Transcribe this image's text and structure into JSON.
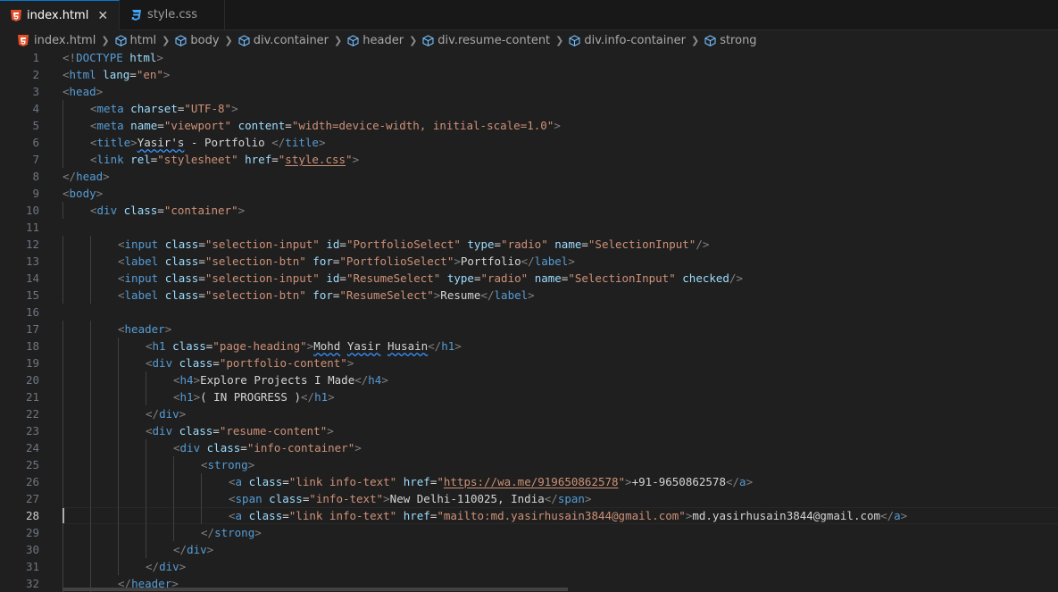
{
  "tabs": [
    {
      "label": "index.html",
      "active": true,
      "icon": "html5-icon"
    },
    {
      "label": "style.css",
      "active": false,
      "icon": "css3-icon"
    }
  ],
  "breadcrumb": [
    "index.html",
    "html",
    "body",
    "div.container",
    "header",
    "div.resume-content",
    "div.info-container",
    "strong"
  ],
  "colors": {
    "accent": "#0078d4",
    "tag": "#569cd6",
    "attribute": "#9cdcfe",
    "string": "#ce9178",
    "html_icon": "#e44d26",
    "css_icon": "#42a5f5"
  },
  "current_line": 28,
  "lines": [
    {
      "n": "1",
      "indent": 0,
      "tokens": [
        [
          "p",
          "<!"
        ],
        [
          "t",
          "DOCTYPE"
        ],
        [
          "tx",
          " "
        ],
        [
          "a",
          "html"
        ],
        [
          "p",
          ">"
        ]
      ]
    },
    {
      "n": "2",
      "indent": 0,
      "tokens": [
        [
          "p",
          "<"
        ],
        [
          "t",
          "html"
        ],
        [
          "tx",
          " "
        ],
        [
          "a",
          "lang"
        ],
        [
          "tx",
          "="
        ],
        [
          "s",
          "\"en\""
        ],
        [
          "p",
          ">"
        ]
      ]
    },
    {
      "n": "3",
      "indent": 0,
      "tokens": [
        [
          "p",
          "<"
        ],
        [
          "t",
          "head"
        ],
        [
          "p",
          ">"
        ]
      ]
    },
    {
      "n": "4",
      "indent": 1,
      "tokens": [
        [
          "p",
          "<"
        ],
        [
          "t",
          "meta"
        ],
        [
          "tx",
          " "
        ],
        [
          "a",
          "charset"
        ],
        [
          "tx",
          "="
        ],
        [
          "s",
          "\"UTF-8\""
        ],
        [
          "p",
          ">"
        ]
      ]
    },
    {
      "n": "5",
      "indent": 1,
      "tokens": [
        [
          "p",
          "<"
        ],
        [
          "t",
          "meta"
        ],
        [
          "tx",
          " "
        ],
        [
          "a",
          "name"
        ],
        [
          "tx",
          "="
        ],
        [
          "s",
          "\"viewport\""
        ],
        [
          "tx",
          " "
        ],
        [
          "a",
          "content"
        ],
        [
          "tx",
          "="
        ],
        [
          "s",
          "\"width=device-width, initial-scale=1.0\""
        ],
        [
          "p",
          ">"
        ]
      ]
    },
    {
      "n": "6",
      "indent": 1,
      "tokens": [
        [
          "p",
          "<"
        ],
        [
          "t",
          "title"
        ],
        [
          "p",
          ">"
        ],
        [
          "tx sq",
          "Yasir's"
        ],
        [
          "tx",
          " - Portfolio "
        ],
        [
          "p",
          "</"
        ],
        [
          "t",
          "title"
        ],
        [
          "p",
          ">"
        ]
      ]
    },
    {
      "n": "7",
      "indent": 1,
      "tokens": [
        [
          "p",
          "<"
        ],
        [
          "t",
          "link"
        ],
        [
          "tx",
          " "
        ],
        [
          "a",
          "rel"
        ],
        [
          "tx",
          "="
        ],
        [
          "s",
          "\"stylesheet\""
        ],
        [
          "tx",
          " "
        ],
        [
          "a",
          "href"
        ],
        [
          "tx",
          "="
        ],
        [
          "s",
          "\""
        ],
        [
          "s ul",
          "style.css"
        ],
        [
          "s",
          "\""
        ],
        [
          "p",
          ">"
        ]
      ]
    },
    {
      "n": "8",
      "indent": 0,
      "tokens": [
        [
          "p",
          "</"
        ],
        [
          "t",
          "head"
        ],
        [
          "p",
          ">"
        ]
      ]
    },
    {
      "n": "9",
      "indent": 0,
      "tokens": [
        [
          "p",
          "<"
        ],
        [
          "t",
          "body"
        ],
        [
          "p",
          ">"
        ]
      ]
    },
    {
      "n": "10",
      "indent": 1,
      "tokens": [
        [
          "p",
          "<"
        ],
        [
          "t",
          "div"
        ],
        [
          "tx",
          " "
        ],
        [
          "a",
          "class"
        ],
        [
          "tx",
          "="
        ],
        [
          "s",
          "\"container\""
        ],
        [
          "p",
          ">"
        ]
      ]
    },
    {
      "n": "11",
      "indent": 0,
      "tokens": []
    },
    {
      "n": "12",
      "indent": 2,
      "tokens": [
        [
          "p",
          "<"
        ],
        [
          "t",
          "input"
        ],
        [
          "tx",
          " "
        ],
        [
          "a",
          "class"
        ],
        [
          "tx",
          "="
        ],
        [
          "s",
          "\"selection-input\""
        ],
        [
          "tx",
          " "
        ],
        [
          "a",
          "id"
        ],
        [
          "tx",
          "="
        ],
        [
          "s",
          "\"PortfolioSelect\""
        ],
        [
          "tx",
          " "
        ],
        [
          "a",
          "type"
        ],
        [
          "tx",
          "="
        ],
        [
          "s",
          "\"radio\""
        ],
        [
          "tx",
          " "
        ],
        [
          "a",
          "name"
        ],
        [
          "tx",
          "="
        ],
        [
          "s",
          "\"SelectionInput\""
        ],
        [
          "p",
          "/>"
        ]
      ]
    },
    {
      "n": "13",
      "indent": 2,
      "tokens": [
        [
          "p",
          "<"
        ],
        [
          "t",
          "label"
        ],
        [
          "tx",
          " "
        ],
        [
          "a",
          "class"
        ],
        [
          "tx",
          "="
        ],
        [
          "s",
          "\"selection-btn\""
        ],
        [
          "tx",
          " "
        ],
        [
          "a",
          "for"
        ],
        [
          "tx",
          "="
        ],
        [
          "s",
          "\"PortfolioSelect\""
        ],
        [
          "p",
          ">"
        ],
        [
          "tx",
          "Portfolio"
        ],
        [
          "p",
          "</"
        ],
        [
          "t",
          "label"
        ],
        [
          "p",
          ">"
        ]
      ]
    },
    {
      "n": "14",
      "indent": 2,
      "tokens": [
        [
          "p",
          "<"
        ],
        [
          "t",
          "input"
        ],
        [
          "tx",
          " "
        ],
        [
          "a",
          "class"
        ],
        [
          "tx",
          "="
        ],
        [
          "s",
          "\"selection-input\""
        ],
        [
          "tx",
          " "
        ],
        [
          "a",
          "id"
        ],
        [
          "tx",
          "="
        ],
        [
          "s",
          "\"ResumeSelect\""
        ],
        [
          "tx",
          " "
        ],
        [
          "a",
          "type"
        ],
        [
          "tx",
          "="
        ],
        [
          "s",
          "\"radio\""
        ],
        [
          "tx",
          " "
        ],
        [
          "a",
          "name"
        ],
        [
          "tx",
          "="
        ],
        [
          "s",
          "\"SelectionInput\""
        ],
        [
          "tx",
          " "
        ],
        [
          "a",
          "checked"
        ],
        [
          "p",
          "/>"
        ]
      ]
    },
    {
      "n": "15",
      "indent": 2,
      "tokens": [
        [
          "p",
          "<"
        ],
        [
          "t",
          "label"
        ],
        [
          "tx",
          " "
        ],
        [
          "a",
          "class"
        ],
        [
          "tx",
          "="
        ],
        [
          "s",
          "\"selection-btn\""
        ],
        [
          "tx",
          " "
        ],
        [
          "a",
          "for"
        ],
        [
          "tx",
          "="
        ],
        [
          "s",
          "\"ResumeSelect\""
        ],
        [
          "p",
          ">"
        ],
        [
          "tx",
          "Resume"
        ],
        [
          "p",
          "</"
        ],
        [
          "t",
          "label"
        ],
        [
          "p",
          ">"
        ]
      ]
    },
    {
      "n": "16",
      "indent": 0,
      "tokens": []
    },
    {
      "n": "17",
      "indent": 2,
      "tokens": [
        [
          "p",
          "<"
        ],
        [
          "t",
          "header"
        ],
        [
          "p",
          ">"
        ]
      ]
    },
    {
      "n": "18",
      "indent": 3,
      "tokens": [
        [
          "p",
          "<"
        ],
        [
          "t",
          "h1"
        ],
        [
          "tx",
          " "
        ],
        [
          "a",
          "class"
        ],
        [
          "tx",
          "="
        ],
        [
          "s",
          "\"page-heading\""
        ],
        [
          "p",
          ">"
        ],
        [
          "tx sq",
          "Mohd"
        ],
        [
          "tx",
          " "
        ],
        [
          "tx sq",
          "Yasir"
        ],
        [
          "tx",
          " "
        ],
        [
          "tx sq",
          "Husain"
        ],
        [
          "p",
          "</"
        ],
        [
          "t",
          "h1"
        ],
        [
          "p",
          ">"
        ]
      ]
    },
    {
      "n": "19",
      "indent": 3,
      "tokens": [
        [
          "p",
          "<"
        ],
        [
          "t",
          "div"
        ],
        [
          "tx",
          " "
        ],
        [
          "a",
          "class"
        ],
        [
          "tx",
          "="
        ],
        [
          "s",
          "\"portfolio-content\""
        ],
        [
          "p",
          ">"
        ]
      ]
    },
    {
      "n": "20",
      "indent": 4,
      "tokens": [
        [
          "p",
          "<"
        ],
        [
          "t",
          "h4"
        ],
        [
          "p",
          ">"
        ],
        [
          "tx",
          "Explore Projects I Made"
        ],
        [
          "p",
          "</"
        ],
        [
          "t",
          "h4"
        ],
        [
          "p",
          ">"
        ]
      ]
    },
    {
      "n": "21",
      "indent": 4,
      "tokens": [
        [
          "p",
          "<"
        ],
        [
          "t",
          "h1"
        ],
        [
          "p",
          ">"
        ],
        [
          "tx",
          "( IN PROGRESS )"
        ],
        [
          "p",
          "</"
        ],
        [
          "t",
          "h1"
        ],
        [
          "p",
          ">"
        ]
      ]
    },
    {
      "n": "22",
      "indent": 3,
      "tokens": [
        [
          "p",
          "</"
        ],
        [
          "t",
          "div"
        ],
        [
          "p",
          ">"
        ]
      ]
    },
    {
      "n": "23",
      "indent": 3,
      "tokens": [
        [
          "p",
          "<"
        ],
        [
          "t",
          "div"
        ],
        [
          "tx",
          " "
        ],
        [
          "a",
          "class"
        ],
        [
          "tx",
          "="
        ],
        [
          "s",
          "\"resume-content\""
        ],
        [
          "p",
          ">"
        ]
      ]
    },
    {
      "n": "24",
      "indent": 4,
      "tokens": [
        [
          "p",
          "<"
        ],
        [
          "t",
          "div"
        ],
        [
          "tx",
          " "
        ],
        [
          "a",
          "class"
        ],
        [
          "tx",
          "="
        ],
        [
          "s",
          "\"info-container\""
        ],
        [
          "p",
          ">"
        ]
      ]
    },
    {
      "n": "25",
      "indent": 5,
      "tokens": [
        [
          "p",
          "<"
        ],
        [
          "t",
          "strong"
        ],
        [
          "p",
          ">"
        ]
      ]
    },
    {
      "n": "26",
      "indent": 6,
      "tokens": [
        [
          "p",
          "<"
        ],
        [
          "t",
          "a"
        ],
        [
          "tx",
          " "
        ],
        [
          "a",
          "class"
        ],
        [
          "tx",
          "="
        ],
        [
          "s",
          "\"link info-text\""
        ],
        [
          "tx",
          " "
        ],
        [
          "a",
          "href"
        ],
        [
          "tx",
          "="
        ],
        [
          "s",
          "\""
        ],
        [
          "s ul",
          "https://wa.me/919650862578"
        ],
        [
          "s",
          "\""
        ],
        [
          "p",
          ">"
        ],
        [
          "tx",
          "+91-9650862578"
        ],
        [
          "p",
          "</"
        ],
        [
          "t",
          "a"
        ],
        [
          "p",
          ">"
        ]
      ]
    },
    {
      "n": "27",
      "indent": 6,
      "tokens": [
        [
          "p",
          "<"
        ],
        [
          "t",
          "span"
        ],
        [
          "tx",
          " "
        ],
        [
          "a",
          "class"
        ],
        [
          "tx",
          "="
        ],
        [
          "s",
          "\"info-text\""
        ],
        [
          "p",
          ">"
        ],
        [
          "tx",
          "New Delhi-110025, India"
        ],
        [
          "p",
          "</"
        ],
        [
          "t",
          "span"
        ],
        [
          "p",
          ">"
        ]
      ]
    },
    {
      "n": "28",
      "indent": 6,
      "tokens": [
        [
          "p",
          "<"
        ],
        [
          "t",
          "a"
        ],
        [
          "tx",
          " "
        ],
        [
          "a",
          "class"
        ],
        [
          "tx",
          "="
        ],
        [
          "s",
          "\"link info-text\""
        ],
        [
          "tx",
          " "
        ],
        [
          "a",
          "href"
        ],
        [
          "tx",
          "="
        ],
        [
          "s",
          "\"mailto:md.yasirhusain3844@gmail.com\""
        ],
        [
          "p",
          ">"
        ],
        [
          "tx",
          "md.yasirhusain3844@gmail.com"
        ],
        [
          "p",
          "</"
        ],
        [
          "t",
          "a"
        ],
        [
          "p",
          ">"
        ]
      ]
    },
    {
      "n": "29",
      "indent": 5,
      "tokens": [
        [
          "p",
          "</"
        ],
        [
          "t",
          "strong"
        ],
        [
          "p",
          ">"
        ]
      ]
    },
    {
      "n": "30",
      "indent": 4,
      "tokens": [
        [
          "p",
          "</"
        ],
        [
          "t",
          "div"
        ],
        [
          "p",
          ">"
        ]
      ]
    },
    {
      "n": "31",
      "indent": 3,
      "tokens": [
        [
          "p",
          "</"
        ],
        [
          "t",
          "div"
        ],
        [
          "p",
          ">"
        ]
      ]
    },
    {
      "n": "32",
      "indent": 2,
      "tokens": [
        [
          "p",
          "</"
        ],
        [
          "t",
          "header"
        ],
        [
          "p",
          ">"
        ]
      ]
    }
  ]
}
